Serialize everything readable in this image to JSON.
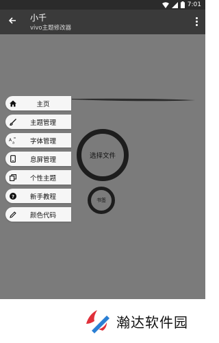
{
  "status_bar": {
    "time": "7:01"
  },
  "app_bar": {
    "title": "小千",
    "subtitle": "vivo主题修改器"
  },
  "menu": {
    "items": [
      {
        "label": "主页",
        "icon": "home-icon"
      },
      {
        "label": "主题管理",
        "icon": "brush-icon"
      },
      {
        "label": "字体管理",
        "icon": "font-icon"
      },
      {
        "label": "息屏管理",
        "icon": "phone-icon"
      },
      {
        "label": "个性主题",
        "icon": "copy-icon"
      },
      {
        "label": "新手教程",
        "icon": "help-icon"
      },
      {
        "label": "颜色代码",
        "icon": "pencil-icon"
      }
    ]
  },
  "actions": {
    "select_file": "选择文件",
    "bookmark": "书签"
  },
  "footer": {
    "brand_text": "瀚达软件园"
  },
  "colors": {
    "status_bar": "#2b2b2b",
    "app_bar": "#3a3a3a",
    "content_bg": "#7b7b7b",
    "ring": "#1d1d1d",
    "menu_bg": "#f6f6f6",
    "logo_accent": "#e0303a"
  }
}
